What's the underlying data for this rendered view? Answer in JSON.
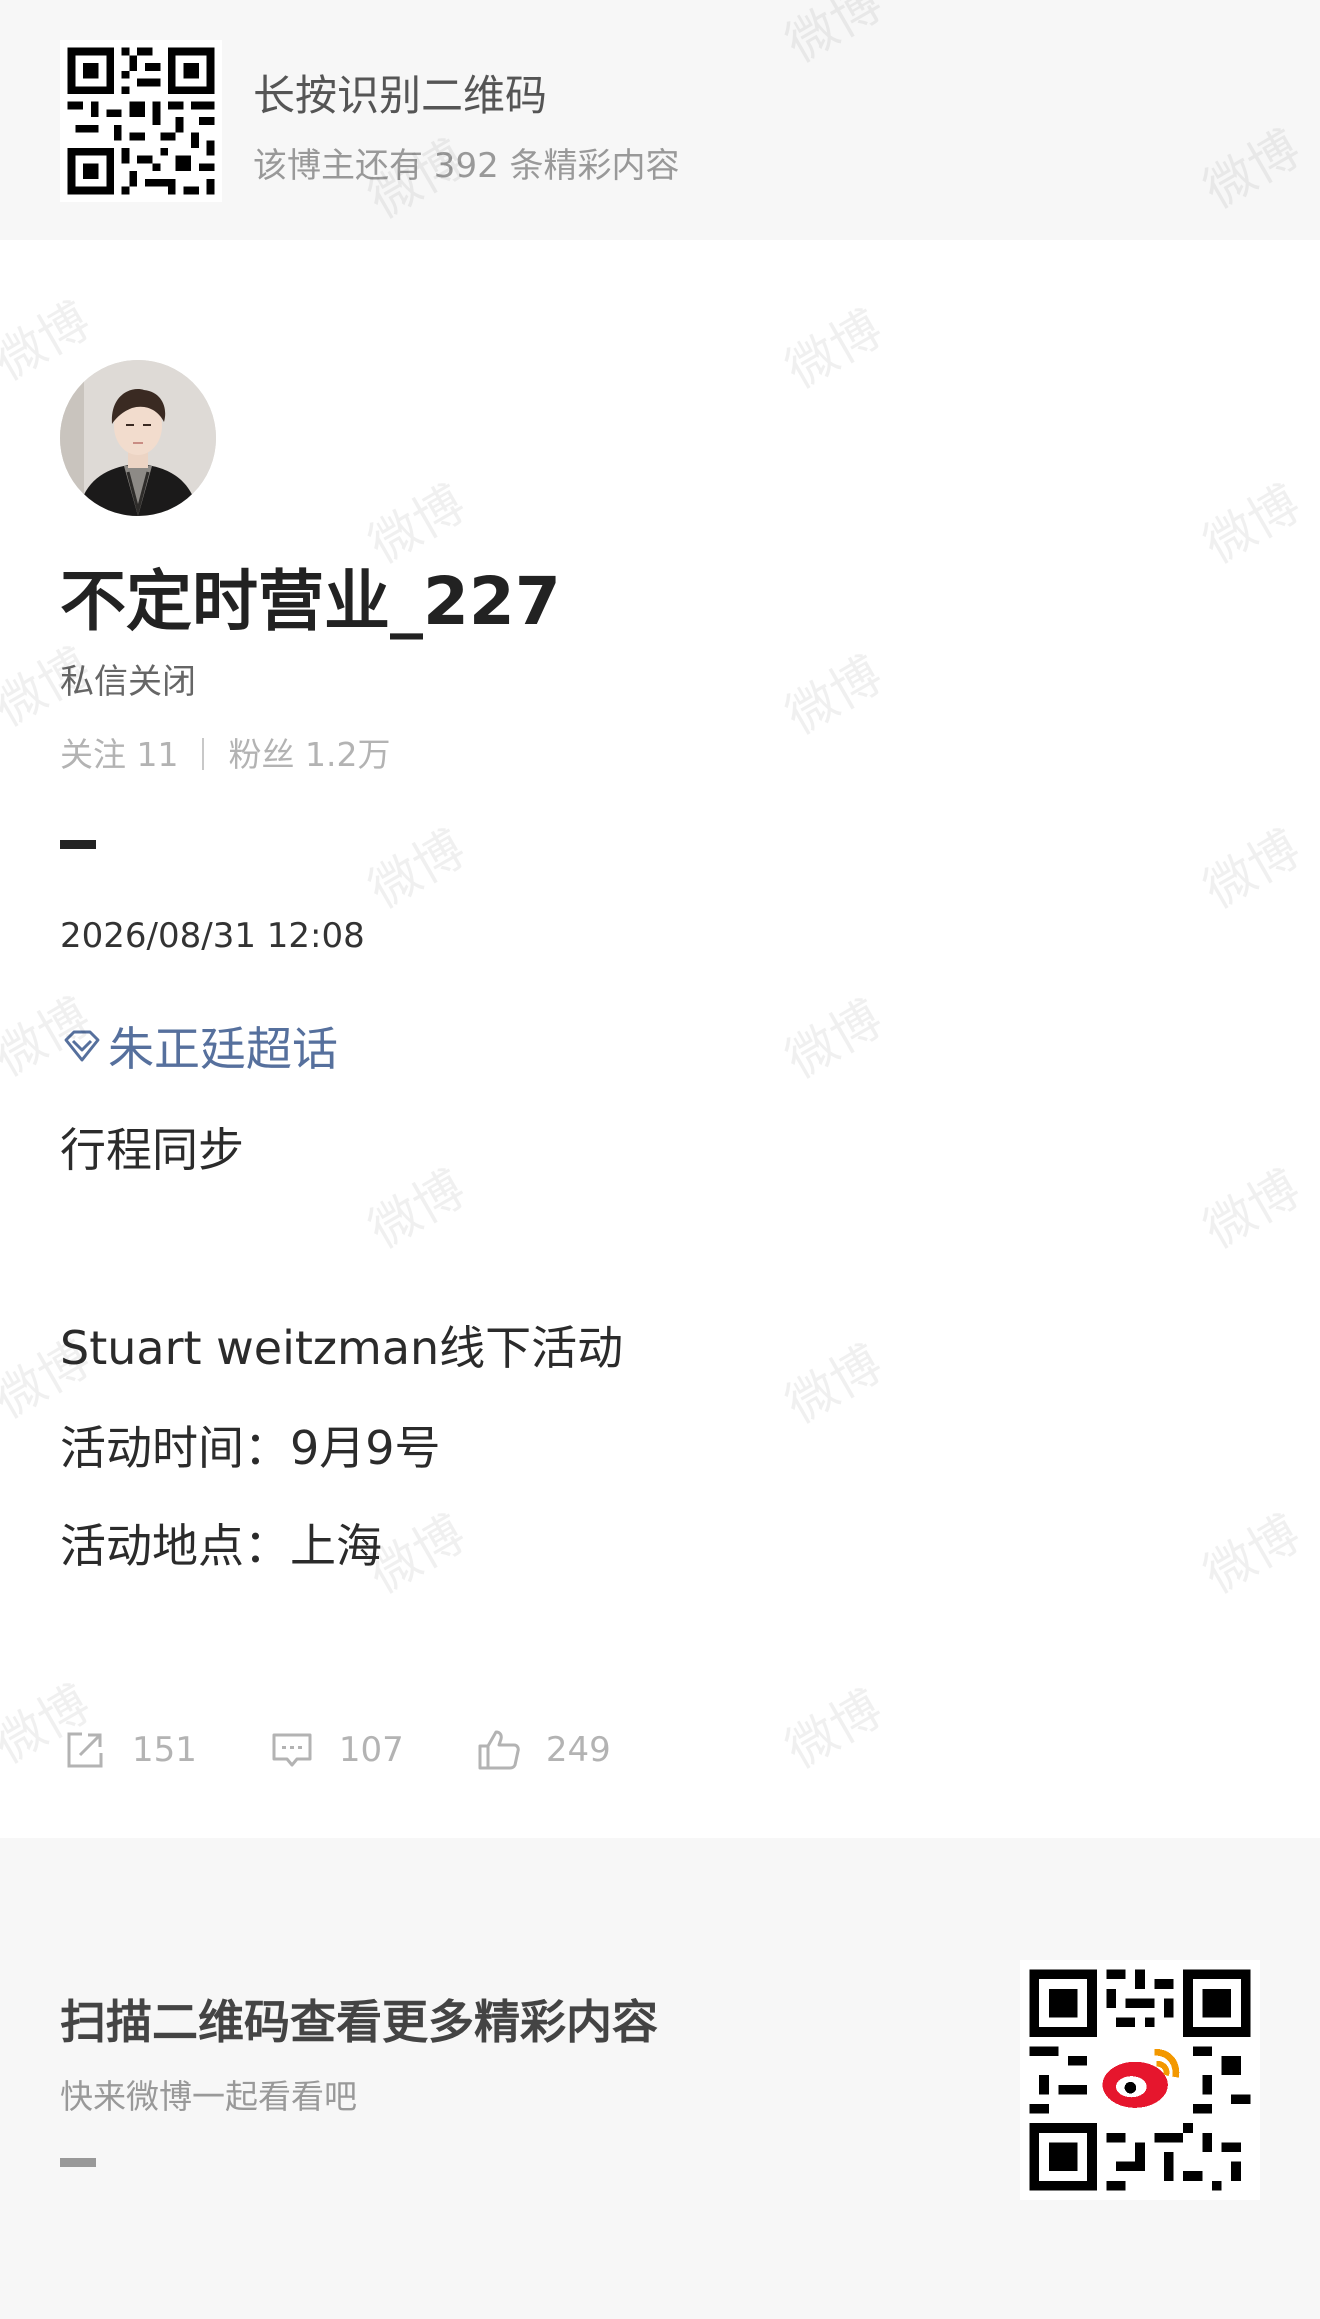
{
  "top_banner": {
    "title": "长按识别二维码",
    "subtitle": "该博主还有 392 条精彩内容"
  },
  "profile": {
    "username": "不定时营业_227",
    "dm_status": "私信关闭",
    "following_label": "关注 11",
    "followers_label": "粉丝 1.2万"
  },
  "post": {
    "timestamp": "2026/08/31 12:08",
    "topic": "朱正廷超话",
    "lines": [
      "行程同步",
      "Stuart weitzman线下活动",
      "活动时间：9月9号",
      "活动地点：上海"
    ]
  },
  "actions": {
    "reposts": "151",
    "comments": "107",
    "likes": "249"
  },
  "bottom": {
    "title": "扫描二维码查看更多精彩内容",
    "subtitle": "快来微博一起看看吧"
  },
  "watermark_text": "微博",
  "colors": {
    "topic_link": "#56709d",
    "muted_text": "#b3b3b3",
    "banner_bg": "#f7f7f7"
  }
}
